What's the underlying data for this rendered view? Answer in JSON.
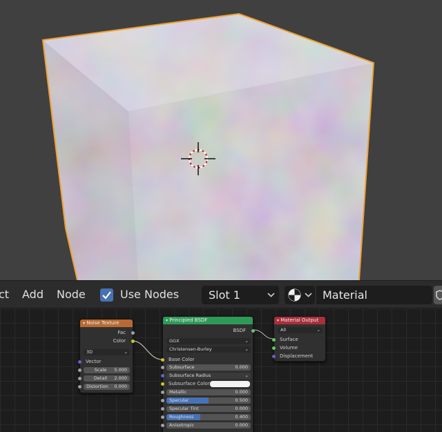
{
  "header": {
    "menu_partial": "ct",
    "menu_add": "Add",
    "menu_node": "Node",
    "use_nodes_label": "Use Nodes",
    "use_nodes_checked": true,
    "slot_value": "Slot 1",
    "material_name": "Material"
  },
  "nodes": {
    "noise": {
      "title": "Noise Texture",
      "out_fac": "Fac",
      "out_color": "Color",
      "dimensions": "3D",
      "in_vector": "Vector",
      "scale_label": "Scale",
      "scale_value": "5.000",
      "detail_label": "Detail",
      "detail_value": "2.000",
      "distortion_label": "Distortion",
      "distortion_value": "0.000"
    },
    "bsdf": {
      "title": "Principled BSDF",
      "out_bsdf": "BSDF",
      "distribution": "GGX",
      "subsurface_method": "Christensen-Burley",
      "base_color": "Base Color",
      "subsurface_label": "Subsurface",
      "subsurface_value": "0.000",
      "subsurface_radius": "Subsurface Radius",
      "subsurface_color": "Subsurface Color",
      "metallic_label": "Metallic",
      "metallic_value": "0.000",
      "specular_label": "Specular",
      "specular_value": "0.500",
      "specular_fill": 0.5,
      "specular_tint_label": "Specular Tint",
      "specular_tint_value": "0.000",
      "roughness_label": "Roughness",
      "roughness_value": "0.400",
      "roughness_fill": 0.4,
      "anisotropic_label": "Anisotropic",
      "anisotropic_value": "0.000"
    },
    "output": {
      "title": "Material Output",
      "target": "All",
      "in_surface": "Surface",
      "in_volume": "Volume",
      "in_displacement": "Displacement"
    }
  },
  "colors": {
    "selection_outline": "#f0a030",
    "noise_header": "#b86a32",
    "bsdf_header": "#2f9a58",
    "output_header": "#a8303a",
    "checkbox": "#4772b3",
    "socket_color": "#c7c729",
    "socket_shader": "#63c763",
    "socket_float": "#a1a1a1",
    "socket_vector": "#6363c7"
  }
}
